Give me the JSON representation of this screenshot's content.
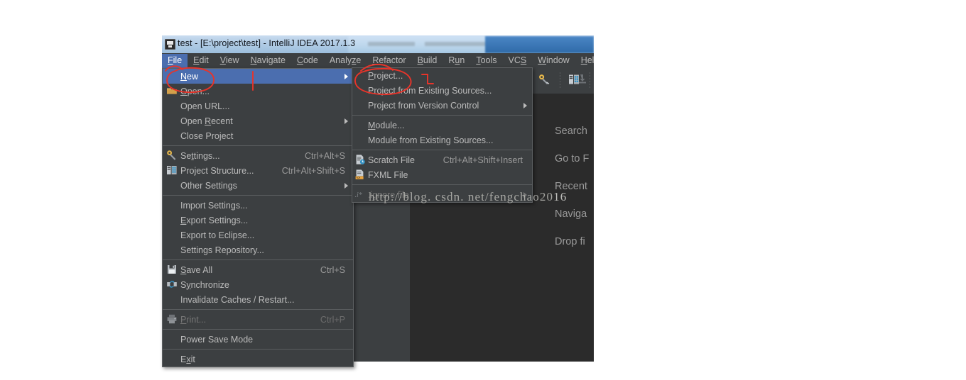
{
  "window": {
    "title": "test - [E:\\project\\test] - IntelliJ IDEA 2017.1.3",
    "icon": "intellij-idea-icon"
  },
  "menubar": {
    "items": [
      {
        "label": "File",
        "mnemonic": "F",
        "selected": true
      },
      {
        "label": "Edit",
        "mnemonic": "E",
        "selected": false
      },
      {
        "label": "View",
        "mnemonic": "V",
        "selected": false
      },
      {
        "label": "Navigate",
        "mnemonic": "N",
        "selected": false
      },
      {
        "label": "Code",
        "mnemonic": "C",
        "selected": false
      },
      {
        "label": "Analyze",
        "mnemonic": "z",
        "selected": false
      },
      {
        "label": "Refactor",
        "mnemonic": "R",
        "selected": false
      },
      {
        "label": "Build",
        "mnemonic": "B",
        "selected": false
      },
      {
        "label": "Run",
        "mnemonic": "u",
        "selected": false
      },
      {
        "label": "Tools",
        "mnemonic": "T",
        "selected": false
      },
      {
        "label": "VCS",
        "mnemonic": "S",
        "selected": false
      },
      {
        "label": "Window",
        "mnemonic": "W",
        "selected": false
      },
      {
        "label": "Help",
        "mnemonic": "H",
        "selected": false
      }
    ]
  },
  "toolbar": {
    "items": [
      {
        "name": "settings-icon",
        "label": "Settings",
        "enabled": true
      },
      {
        "name": "project-structure-icon",
        "label": "Project Structure",
        "enabled": true
      },
      {
        "name": "unknown-tool-icon",
        "label": "",
        "enabled": false
      }
    ]
  },
  "welcome_panel": {
    "lines": [
      "Search",
      "Go to F",
      "Recent",
      "Naviga",
      "Drop fi"
    ]
  },
  "file_menu": {
    "items": [
      {
        "label": "New",
        "mnemonic": "N",
        "accel": "",
        "icon": "",
        "submenu": true,
        "selected": true,
        "enabled": true
      },
      {
        "label": "Open...",
        "mnemonic": "O",
        "accel": "",
        "icon": "folder-icon",
        "submenu": false,
        "selected": false,
        "enabled": true
      },
      {
        "label": "Open URL...",
        "mnemonic": "",
        "accel": "",
        "icon": "",
        "submenu": false,
        "selected": false,
        "enabled": true
      },
      {
        "label": "Open Recent",
        "mnemonic": "R",
        "accel": "",
        "icon": "",
        "submenu": true,
        "selected": false,
        "enabled": true
      },
      {
        "label": "Close Project",
        "mnemonic": "",
        "accel": "",
        "icon": "",
        "submenu": false,
        "selected": false,
        "enabled": true
      },
      {
        "separator": true
      },
      {
        "label": "Settings...",
        "mnemonic": "t",
        "accel": "Ctrl+Alt+S",
        "icon": "settings-icon",
        "submenu": false,
        "selected": false,
        "enabled": true
      },
      {
        "label": "Project Structure...",
        "mnemonic": "",
        "accel": "Ctrl+Alt+Shift+S",
        "icon": "project-structure-icon",
        "submenu": false,
        "selected": false,
        "enabled": true
      },
      {
        "label": "Other Settings",
        "mnemonic": "",
        "accel": "",
        "icon": "",
        "submenu": true,
        "selected": false,
        "enabled": true
      },
      {
        "separator": true
      },
      {
        "label": "Import Settings...",
        "mnemonic": "",
        "accel": "",
        "icon": "",
        "submenu": false,
        "selected": false,
        "enabled": true
      },
      {
        "label": "Export Settings...",
        "mnemonic": "E",
        "accel": "",
        "icon": "",
        "submenu": false,
        "selected": false,
        "enabled": true
      },
      {
        "label": "Export to Eclipse...",
        "mnemonic": "",
        "accel": "",
        "icon": "",
        "submenu": false,
        "selected": false,
        "enabled": true
      },
      {
        "label": "Settings Repository...",
        "mnemonic": "",
        "accel": "",
        "icon": "",
        "submenu": false,
        "selected": false,
        "enabled": true
      },
      {
        "separator": true
      },
      {
        "label": "Save All",
        "mnemonic": "S",
        "accel": "Ctrl+S",
        "icon": "save-all-icon",
        "submenu": false,
        "selected": false,
        "enabled": true
      },
      {
        "label": "Synchronize",
        "mnemonic": "y",
        "accel": "",
        "icon": "synchronize-icon",
        "submenu": false,
        "selected": false,
        "enabled": true
      },
      {
        "label": "Invalidate Caches / Restart...",
        "mnemonic": "",
        "accel": "",
        "icon": "",
        "submenu": false,
        "selected": false,
        "enabled": true
      },
      {
        "separator": true
      },
      {
        "label": "Print...",
        "mnemonic": "P",
        "accel": "Ctrl+P",
        "icon": "print-icon",
        "submenu": false,
        "selected": false,
        "enabled": false
      },
      {
        "separator": true
      },
      {
        "label": "Power Save Mode",
        "mnemonic": "",
        "accel": "",
        "icon": "",
        "submenu": false,
        "selected": false,
        "enabled": true
      },
      {
        "separator": true
      },
      {
        "label": "Exit",
        "mnemonic": "x",
        "accel": "",
        "icon": "",
        "submenu": false,
        "selected": false,
        "enabled": true
      }
    ]
  },
  "new_submenu": {
    "items": [
      {
        "label": "Project...",
        "mnemonic": "P",
        "accel": "",
        "icon": "",
        "submenu": false,
        "selected": false,
        "enabled": true
      },
      {
        "label": "Project from Existing Sources...",
        "mnemonic": "",
        "accel": "",
        "icon": "",
        "submenu": false,
        "selected": false,
        "enabled": true
      },
      {
        "label": "Project from Version Control",
        "mnemonic": "",
        "accel": "",
        "icon": "",
        "submenu": true,
        "selected": false,
        "enabled": true
      },
      {
        "separator": true
      },
      {
        "label": "Module...",
        "mnemonic": "M",
        "accel": "",
        "icon": "",
        "submenu": false,
        "selected": false,
        "enabled": true
      },
      {
        "label": "Module from Existing Sources...",
        "mnemonic": "",
        "accel": "",
        "icon": "",
        "submenu": false,
        "selected": false,
        "enabled": true
      },
      {
        "separator": true
      },
      {
        "label": "Scratch File",
        "mnemonic": "",
        "accel": "Ctrl+Alt+Shift+Insert",
        "icon": "scratch-file-icon",
        "submenu": false,
        "selected": false,
        "enabled": true
      },
      {
        "label": "FXML File",
        "mnemonic": "",
        "accel": "",
        "icon": "fxml-file-icon",
        "submenu": false,
        "selected": false,
        "enabled": true
      },
      {
        "separator": true
      },
      {
        "label": ".ignore file",
        "mnemonic": "",
        "accel": "",
        "icon": "ignore-file-icon",
        "submenu": true,
        "selected": false,
        "enabled": false
      }
    ]
  },
  "watermark": {
    "text": "http://blog. csdn. net/fengchao20",
    "text_dim": "16"
  },
  "annotations": {
    "color": "#e8342a",
    "marks": [
      {
        "name": "circle-around-new-item",
        "shape": "ellipse"
      },
      {
        "name": "circle-around-project-item",
        "shape": "ellipse"
      },
      {
        "name": "arc-under-file-menu",
        "shape": "arc"
      },
      {
        "name": "arc-under-refactor-menu",
        "shape": "arc"
      },
      {
        "name": "vertical-tick-in-new-row",
        "shape": "line"
      },
      {
        "name": "bracket-right-of-project",
        "shape": "bracket"
      }
    ]
  },
  "colors": {
    "menu_bg": "#3c3f41",
    "menu_selected": "#4b6eaf",
    "panel_dark": "#2b2b2b",
    "text": "#bbbbbb",
    "accent_red": "#e8342a"
  }
}
